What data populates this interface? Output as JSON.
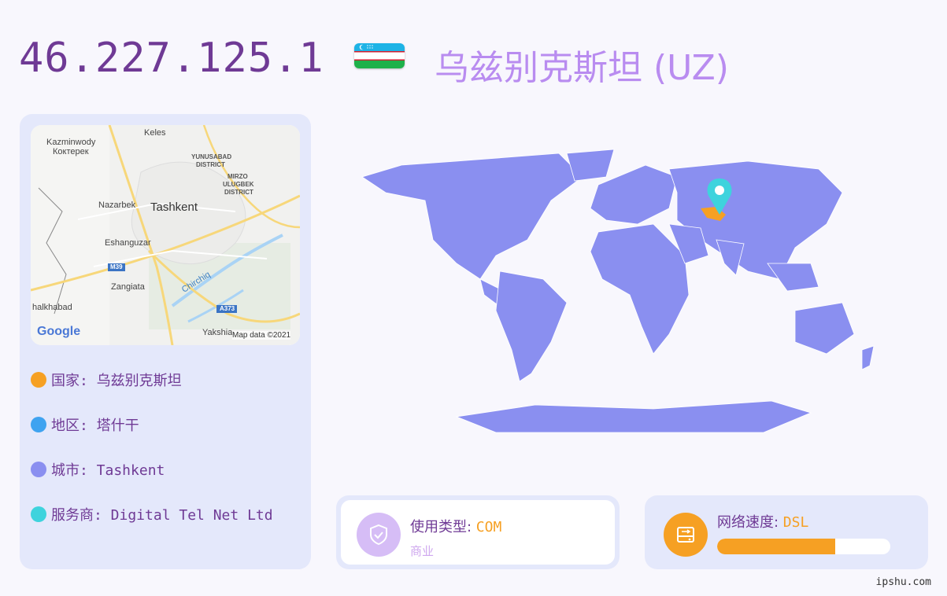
{
  "header": {
    "ip": "46.227.125.1",
    "country_title": "乌兹别克斯坦 (UZ)",
    "flag_icon": "uzbekistan-flag-icon"
  },
  "mini_map": {
    "places": [
      "Keles",
      "Kazminwody",
      "Кoктерек",
      "YUNUSABAD",
      "DISTRICT",
      "MIRZO",
      "ULUGBEK",
      "DISTRICT",
      "Nazarbek",
      "Tashkent",
      "Eshanguzar",
      "M39",
      "Zangiata",
      "Chirchiq",
      "halkhabad",
      "A373",
      "Yakshia"
    ],
    "logo": "Google",
    "attribution": "Map data ©2021"
  },
  "info": [
    {
      "label": "国家: 乌兹别克斯坦",
      "color": "#f6a023"
    },
    {
      "label": "地区: 塔什干",
      "color": "#3fa3f0"
    },
    {
      "label": "城市: Tashkent",
      "color": "#8a8ff0"
    },
    {
      "label": "服务商: Digital Tel Net Ltd",
      "color": "#3ed3dd"
    }
  ],
  "usage": {
    "label": "使用类型: ",
    "value": "COM",
    "sub": "商业",
    "icon": "shield-check-icon"
  },
  "speed": {
    "label": "网络速度: ",
    "value": "DSL",
    "icon": "network-drive-icon",
    "level": 0.68
  },
  "colors": {
    "accent": "#6f3a95",
    "map_fill": "#8a8ff0",
    "highlight": "#f6a023",
    "pin": "#3ed3dd"
  },
  "watermark": "ipshu.com"
}
